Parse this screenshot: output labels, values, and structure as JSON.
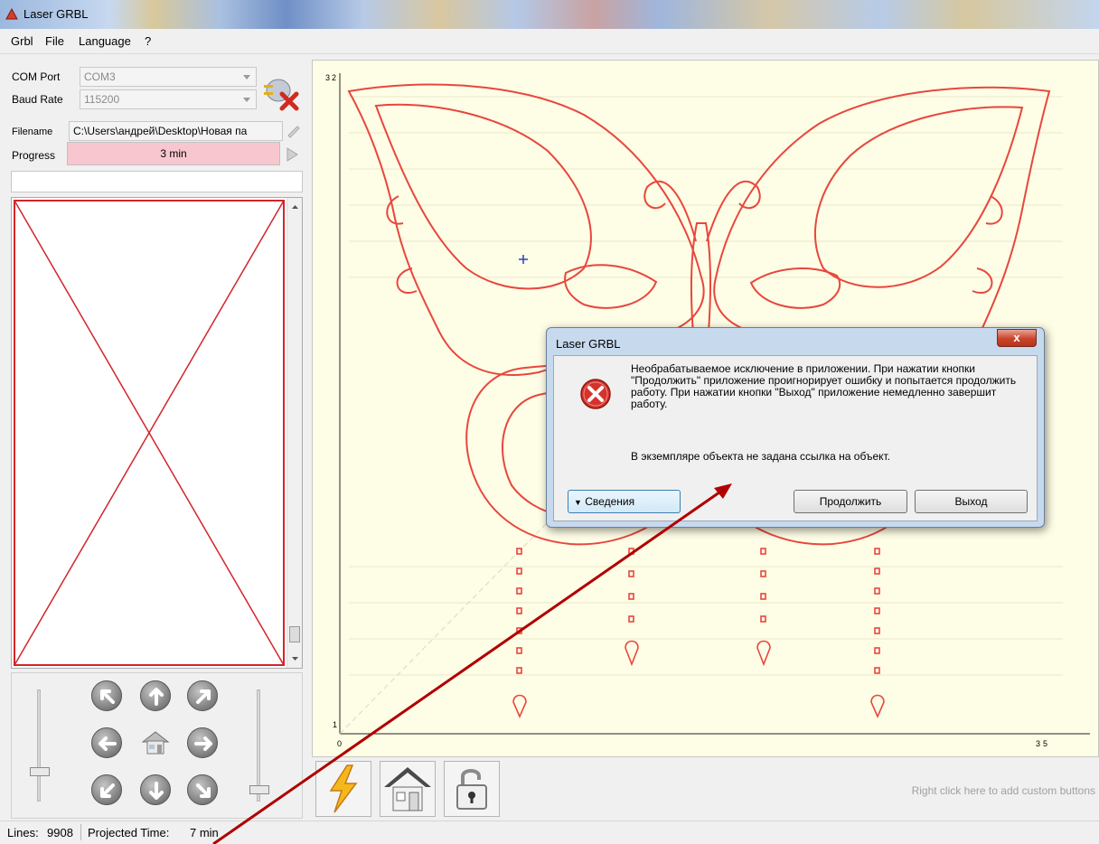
{
  "window": {
    "title": "Laser GRBL"
  },
  "menu": {
    "items": [
      "Grbl",
      "File",
      "Language",
      "?"
    ]
  },
  "connection": {
    "com_label": "COM Port",
    "com_value": "COM3",
    "baud_label": "Baud Rate",
    "baud_value": "115200",
    "connect_icon": "disconnect-icon"
  },
  "file": {
    "filename_label": "Filename",
    "filename_value": "C:\\Users\\андрей\\Desktop\\Новая па",
    "progress_label": "Progress",
    "progress_text": "3 min",
    "progress_fraction": 1.0
  },
  "canvas": {
    "y_top": "32",
    "y_bottom": "1",
    "x_left": "0",
    "x_right": "35",
    "line_color": "#e8473d",
    "background": "#fefde6"
  },
  "toolbar": {
    "hint": "Right click here to add custom buttons",
    "buttons": [
      "lightning-icon",
      "home-icon",
      "unlock-icon"
    ]
  },
  "status": {
    "lines_label": "Lines:",
    "lines_value": "9908",
    "time_label": "Projected Time:",
    "time_value": "7 min"
  },
  "dialog": {
    "title": "Laser GRBL",
    "close_label": "x",
    "message": "Необрабатываемое исключение в приложении. При нажатии кнопки \"Продолжить\" приложение проигнорирует ошибку и попытается продолжить работу. При нажатии кнопки \"Выход\" приложение немедленно завершит работу.",
    "detail": "В экземпляре объекта не задана ссылка на объект.",
    "details_button": "Сведения",
    "continue_button": "Продолжить",
    "exit_button": "Выход",
    "icon": "error-icon"
  },
  "annotation": {
    "arrow_color": "#b00000"
  }
}
